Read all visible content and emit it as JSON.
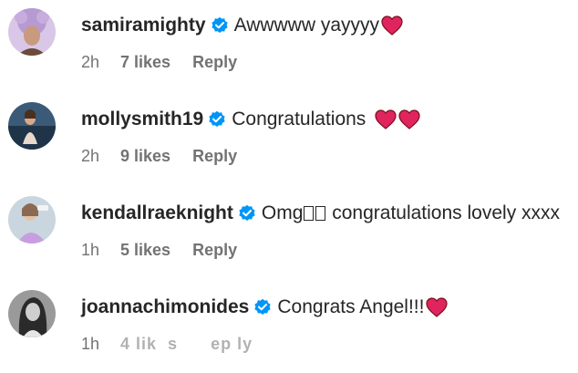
{
  "comments": [
    {
      "username": "samiramighty",
      "text": "Awwwww yayyyy",
      "trailing_hearts": 1,
      "time": "2h",
      "likes": "7 likes",
      "reply": "Reply"
    },
    {
      "username": "mollysmith19",
      "text": "Congratulations",
      "trailing_hearts": 2,
      "time": "2h",
      "likes": "9 likes",
      "reply": "Reply"
    },
    {
      "username": "kendallraeknight",
      "text_before": "Omg",
      "text_after": " congratulations lovely xxxx",
      "time": "1h",
      "likes": "5 likes",
      "reply": "Reply"
    },
    {
      "username": "joannachimonides",
      "text": "Congrats Angel!!!",
      "trailing_hearts": 1,
      "time": "1h",
      "likes": "4 lik  s",
      "reply": "  ep ly"
    }
  ],
  "colors": {
    "text": "#262626",
    "meta": "#737373",
    "verified": "#0095f6",
    "heart": "#e0245e"
  },
  "icons": {
    "verified": "verified-badge-icon",
    "heart": "red-heart-emoji-icon"
  }
}
